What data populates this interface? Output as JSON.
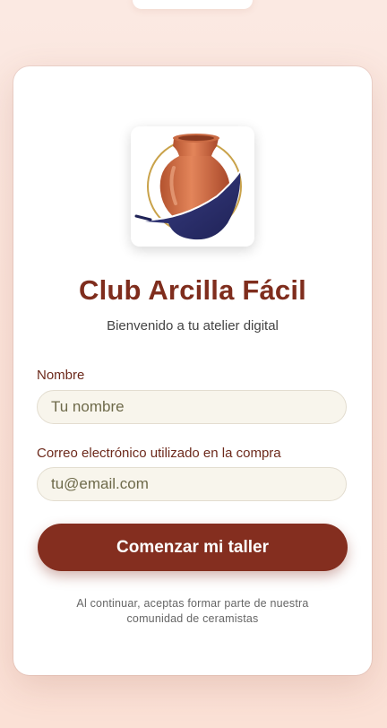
{
  "title": "Club Arcilla Fácil",
  "subtitle": "Bienvenido a tu atelier digital",
  "form": {
    "name_label": "Nombre",
    "name_placeholder": "Tu nombre",
    "email_label": "Correo electrónico utilizado en la compra",
    "email_placeholder": "tu@email.com",
    "submit_label": "Comenzar mi taller"
  },
  "legal": {
    "line1": "Al continuar, aceptas formar parte de nuestra",
    "line2": "comunidad de ceramistas"
  },
  "colors": {
    "brand": "#842e1f",
    "title": "#7f2d1d",
    "input_bg": "#f8f5ec",
    "logo_vase": "#d9744a",
    "logo_swoosh": "#2b2f6f",
    "logo_ring": "#c9a24a"
  },
  "icons": {
    "logo": "clay-vase-logo"
  }
}
